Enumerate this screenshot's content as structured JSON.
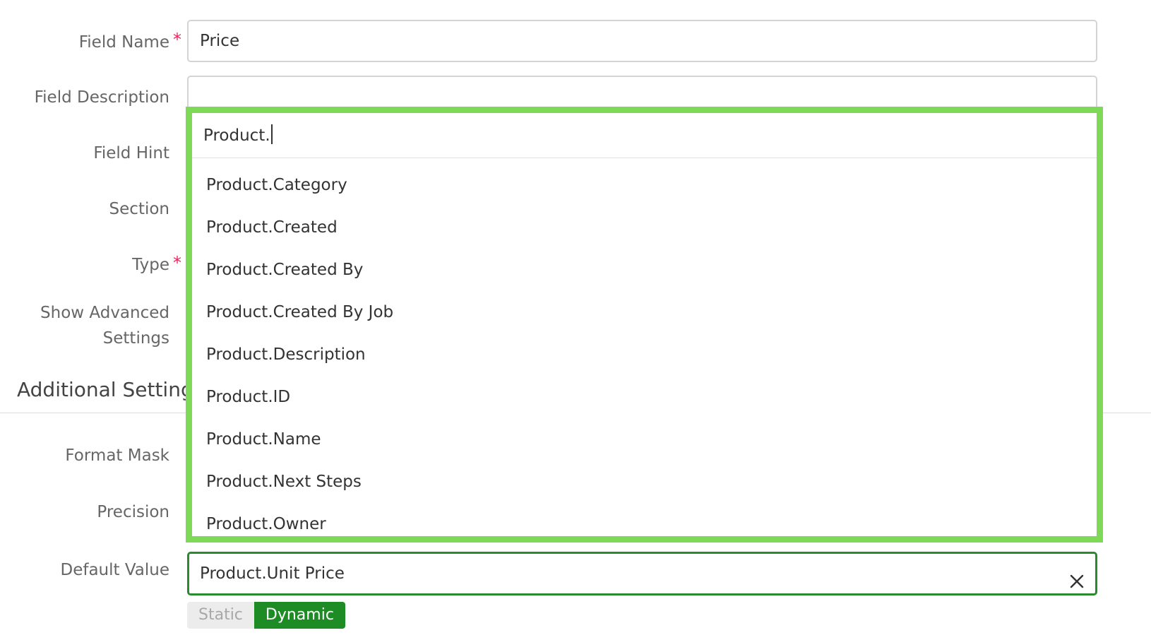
{
  "form": {
    "labels": {
      "field_name": "Field Name",
      "field_description": "Field Description",
      "field_hint": "Field Hint",
      "section": "Section",
      "type": "Type",
      "show_advanced_line1": "Show Advanced",
      "show_advanced_line2": "Settings",
      "format_mask": "Format Mask",
      "precision": "Precision",
      "default_value": "Default Value"
    },
    "required_marker": "*",
    "field_name_value": "Price",
    "field_description_value": ""
  },
  "additional_settings": {
    "heading": "Additional Settings"
  },
  "dropdown": {
    "search_value": "Product.",
    "items": [
      {
        "label": "Product.Category"
      },
      {
        "label": "Product.Created"
      },
      {
        "label": "Product.Created By"
      },
      {
        "label": "Product.Created By Job"
      },
      {
        "label": "Product.Description"
      },
      {
        "label": "Product.ID"
      },
      {
        "label": "Product.Name"
      },
      {
        "label": "Product.Next Steps"
      },
      {
        "label": "Product.Owner"
      }
    ]
  },
  "default_value": {
    "value": "Product.Unit Price",
    "clear_icon": "close-icon"
  },
  "value_mode_toggle": {
    "static_label": "Static",
    "dynamic_label": "Dynamic",
    "selected": "Dynamic"
  },
  "colors": {
    "highlight_border": "#7ed957",
    "focus_border": "#2a8a2f",
    "active_toggle": "#1e8c24",
    "required": "#e8265e"
  }
}
